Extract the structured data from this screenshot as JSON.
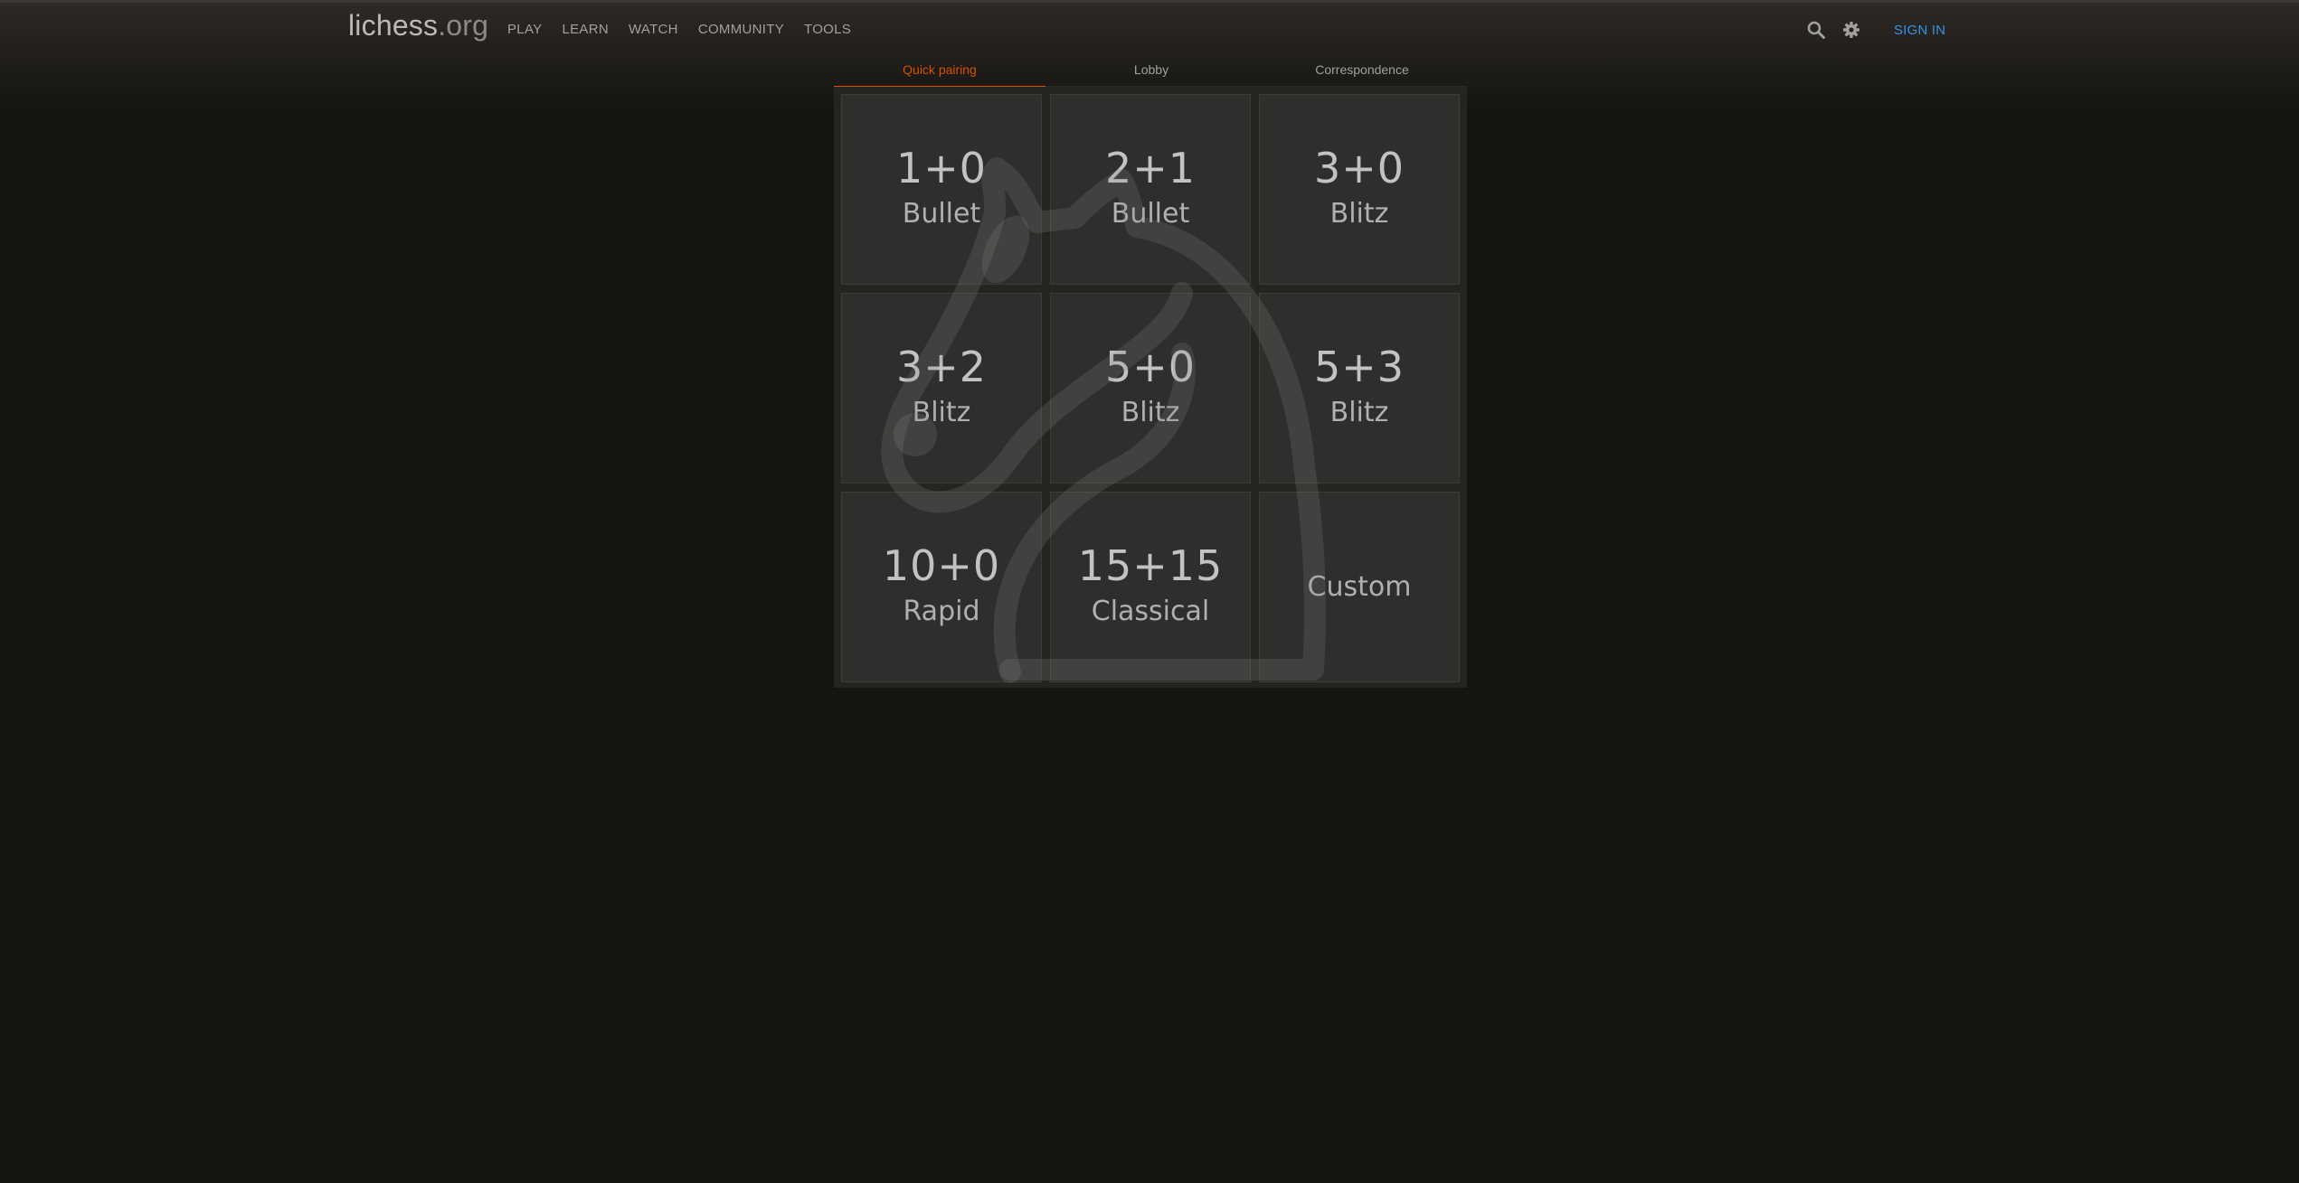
{
  "header": {
    "logo_main": "lichess",
    "logo_tld": ".org",
    "nav": [
      "PLAY",
      "LEARN",
      "WATCH",
      "COMMUNITY",
      "TOOLS"
    ],
    "icons": [
      "search-icon",
      "gear-icon"
    ],
    "sign_in": "SIGN IN"
  },
  "tabs": [
    {
      "label": "Quick pairing",
      "active": true
    },
    {
      "label": "Lobby",
      "active": false
    },
    {
      "label": "Correspondence",
      "active": false
    }
  ],
  "pool": [
    {
      "clock": "1+0",
      "perf": "Bullet"
    },
    {
      "clock": "2+1",
      "perf": "Bullet"
    },
    {
      "clock": "3+0",
      "perf": "Blitz"
    },
    {
      "clock": "3+2",
      "perf": "Blitz"
    },
    {
      "clock": "5+0",
      "perf": "Blitz"
    },
    {
      "clock": "5+3",
      "perf": "Blitz"
    },
    {
      "clock": "10+0",
      "perf": "Rapid"
    },
    {
      "clock": "15+15",
      "perf": "Classical"
    },
    {
      "custom": "Custom"
    }
  ],
  "colors": {
    "background": "#161512",
    "accent": "#d85000",
    "link": "#3692e7"
  }
}
